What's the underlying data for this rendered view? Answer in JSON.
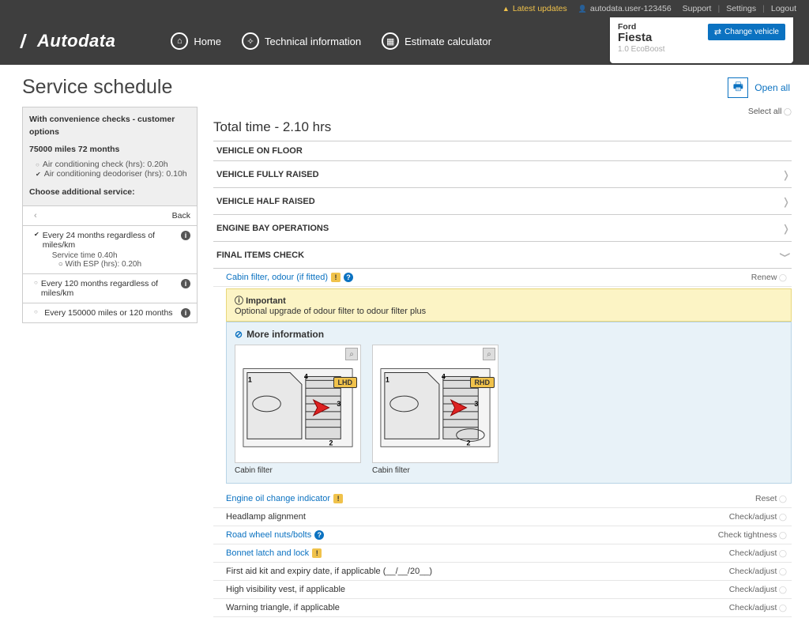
{
  "topbar": {
    "latest": "Latest updates",
    "user": "autodata.user-123456",
    "support": "Support",
    "settings": "Settings",
    "logout": "Logout"
  },
  "nav": {
    "brand": "Autodata",
    "home": "Home",
    "tech": "Technical information",
    "est": "Estimate calculator"
  },
  "vehicle": {
    "make": "Ford",
    "model": "Fiesta",
    "engine": "1.0 EcoBoost",
    "change": "Change vehicle"
  },
  "page": {
    "title": "Service schedule",
    "open_all": "Open all",
    "select_all": "Select all",
    "total_time": "Total time - 2.10 hrs"
  },
  "sidebar": {
    "heading": "With convenience checks - customer options",
    "interval": "75000 miles 72 months",
    "cond1": "Air conditioning check (hrs): 0.20h",
    "cond2": "Air conditioning deodoriser (hrs): 0.10h",
    "choose": "Choose additional service:",
    "back": "Back",
    "opt_sel": "Every 24 months regardless of miles/km",
    "svc_time": "Service time 0.40h",
    "esp": "With ESP (hrs): 0.20h",
    "opt2": "Every 120 months regardless of miles/km",
    "opt3": "Every 150000 miles or 120 months"
  },
  "stages": {
    "floor": "VEHICLE ON FLOOR",
    "full": "VEHICLE FULLY RAISED",
    "half": "VEHICLE HALF RAISED",
    "bay": "ENGINE BAY OPERATIONS",
    "final": "FINAL ITEMS CHECK"
  },
  "cabin": {
    "label": "Cabin filter, odour (if fitted)",
    "action": "Renew",
    "imp_t": "Important",
    "imp_b": "Optional upgrade of odour filter to odour filter plus",
    "more": "More information",
    "cap1": "Cabin filter",
    "cap2": "Cabin filter",
    "tag1": "LHD",
    "tag2": "RHD"
  },
  "items": {
    "i1": {
      "l": "Engine oil change indicator",
      "a": "Reset"
    },
    "i2": {
      "l": "Headlamp alignment",
      "a": "Check/adjust"
    },
    "i3": {
      "l": "Road wheel nuts/bolts",
      "a": "Check tightness"
    },
    "i4": {
      "l": "Bonnet latch and lock",
      "a": "Check/adjust"
    },
    "i5": {
      "l": "First aid kit and expiry date, if applicable (__/__/20__)",
      "a": "Check/adjust"
    },
    "i6": {
      "l": "High visibility vest, if applicable",
      "a": "Check/adjust"
    },
    "i7": {
      "l": "Warning triangle, if applicable",
      "a": "Check/adjust"
    }
  }
}
